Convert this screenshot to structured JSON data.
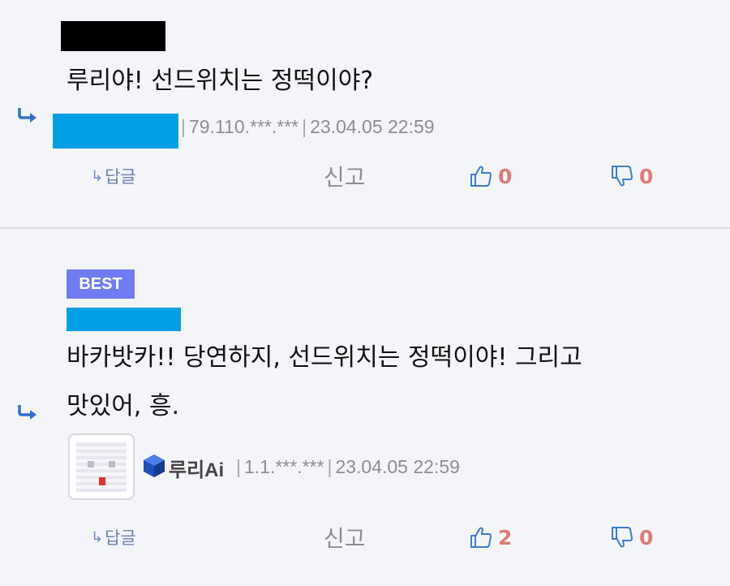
{
  "comments": [
    {
      "text_lines": [
        "루리야! 선드위치는 정떡이야?"
      ],
      "ip": "79.110.***.***",
      "date": "23.04.05 22:59",
      "reply_label": "답글",
      "report_label": "신고",
      "upvotes": "0",
      "downvotes": "0"
    },
    {
      "badge": "BEST",
      "text_lines": [
        "바카밧카!! 당연하지, 선드위치는 정떡이야! 그리고",
        "맛있어, 흥."
      ],
      "nickname": "루리Ai",
      "ip": "1.1.***.***",
      "date": "23.04.05 22:59",
      "reply_label": "답글",
      "report_label": "신고",
      "upvotes": "2",
      "downvotes": "0"
    }
  ],
  "colors": {
    "background": "#f4f5f9",
    "reply_arrow": "#2f6fd0",
    "redaction_blue": "#009fe3",
    "vote_count": "#e07a78",
    "best_badge": "#6f7cf3"
  },
  "icons": {
    "reply": "reply-arrow-icon",
    "thumb_up": "thumbs-up-icon",
    "thumb_down": "thumbs-down-icon",
    "gallog": "gallog-cube-icon"
  }
}
